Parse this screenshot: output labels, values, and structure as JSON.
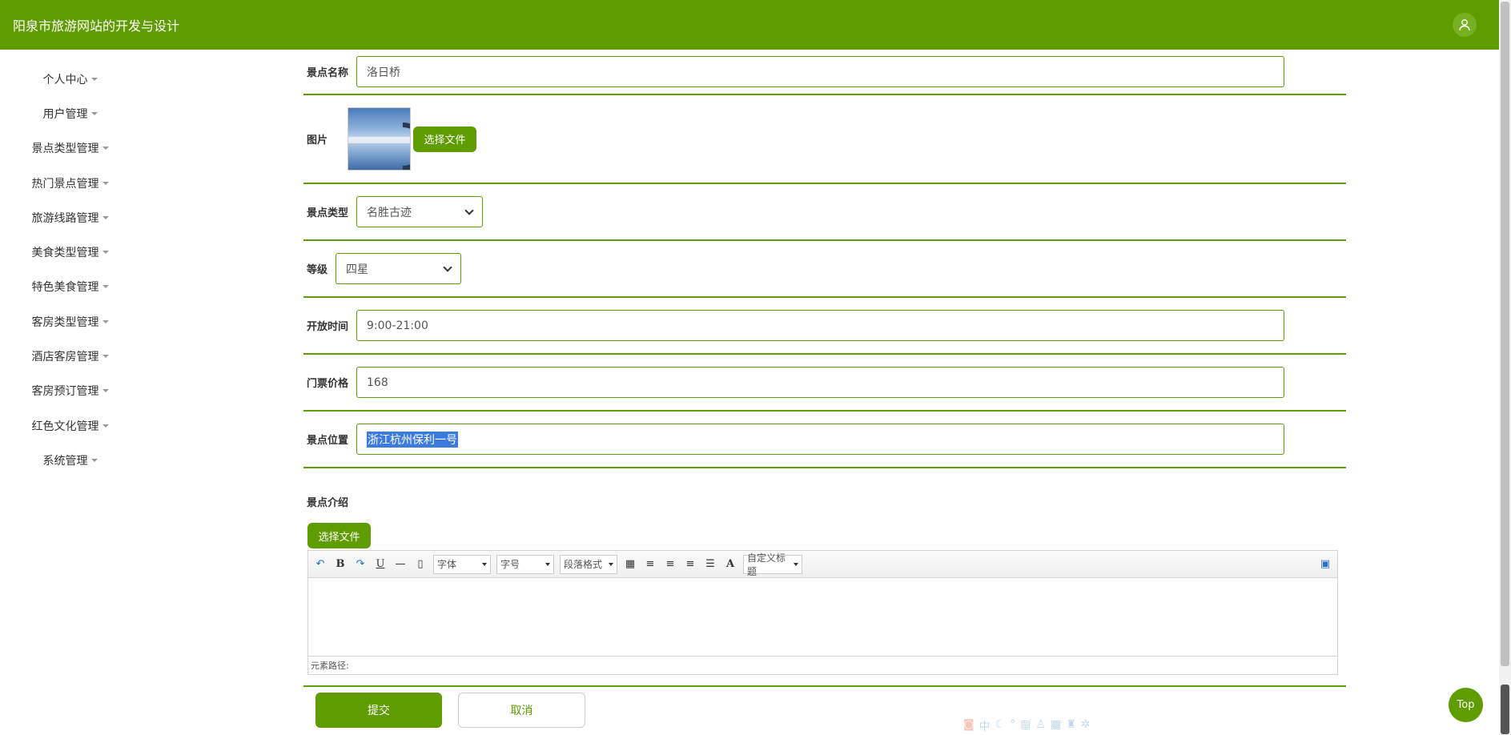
{
  "header": {
    "title": "阳泉市旅游网站的开发与设计",
    "user_icon": "user-icon"
  },
  "sidebar": {
    "items": [
      {
        "label": "个人中心"
      },
      {
        "label": "用户管理"
      },
      {
        "label": "景点类型管理"
      },
      {
        "label": "热门景点管理"
      },
      {
        "label": "旅游线路管理"
      },
      {
        "label": "美食类型管理"
      },
      {
        "label": "特色美食管理"
      },
      {
        "label": "客房类型管理"
      },
      {
        "label": "酒店客房管理"
      },
      {
        "label": "客房预订管理"
      },
      {
        "label": "红色文化管理"
      },
      {
        "label": "系统管理"
      }
    ]
  },
  "form": {
    "name": {
      "label": "景点名称",
      "value": "洛日桥"
    },
    "image": {
      "label": "图片",
      "button": "选择文件"
    },
    "type": {
      "label": "景点类型",
      "value": "名胜古迹"
    },
    "level": {
      "label": "等级",
      "value": "四星"
    },
    "hours": {
      "label": "开放时间",
      "value": "9:00-21:00"
    },
    "price": {
      "label": "门票价格",
      "value": "168"
    },
    "location": {
      "label": "景点位置",
      "value": "浙江杭州保利一号"
    },
    "intro": {
      "label": "景点介绍",
      "button": "选择文件"
    }
  },
  "editor": {
    "font_family": "字体",
    "font_size": "字号",
    "paragraph": "段落格式",
    "custom_title": "自定义标题",
    "bold": "B",
    "underline": "U",
    "font_color": "A",
    "path_label": "元素路径:"
  },
  "actions": {
    "submit": "提交",
    "cancel": "取消"
  },
  "top_button": "Top",
  "colors": {
    "primary": "#5e9c00",
    "selection": "#3b7be0"
  }
}
